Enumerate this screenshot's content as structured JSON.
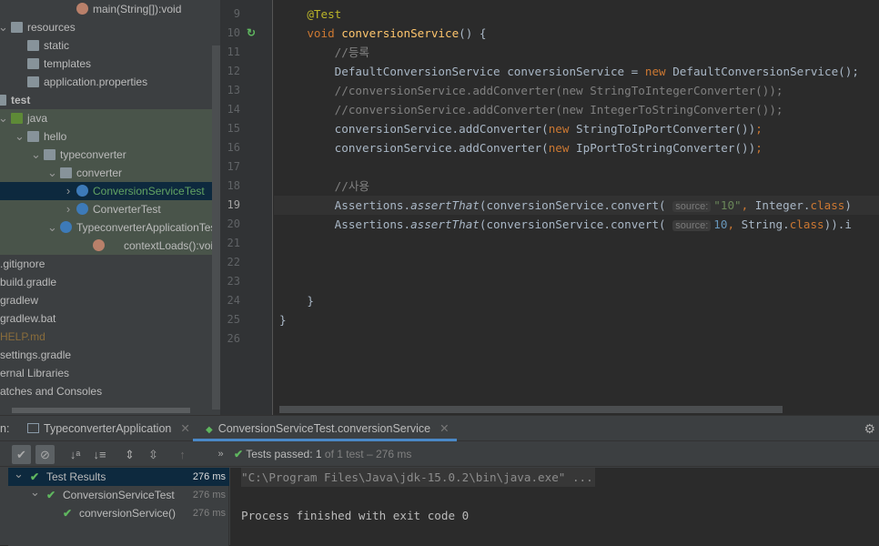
{
  "project_tree": [
    {
      "label": "main(String[]):void",
      "type": "method",
      "depth": 5,
      "arrow": ""
    },
    {
      "label": "resources",
      "type": "folder-res",
      "depth": 1,
      "arrow": "v"
    },
    {
      "label": "static",
      "type": "folder",
      "depth": 2,
      "arrow": ""
    },
    {
      "label": "templates",
      "type": "folder",
      "depth": 2,
      "arrow": ""
    },
    {
      "label": "application.properties",
      "type": "properties",
      "depth": 2,
      "arrow": ""
    },
    {
      "label": "test",
      "type": "folder-test",
      "depth": 0,
      "arrow": "",
      "bold": true
    },
    {
      "label": "java",
      "type": "folder-src",
      "depth": 1,
      "arrow": "v",
      "green": true
    },
    {
      "label": "hello",
      "type": "package",
      "depth": 2,
      "arrow": "v",
      "green": true
    },
    {
      "label": "typeconverter",
      "type": "package",
      "depth": 3,
      "arrow": "v",
      "green": true
    },
    {
      "label": "converter",
      "type": "package",
      "depth": 4,
      "arrow": "v",
      "green": true
    },
    {
      "label": "ConversionServiceTest",
      "type": "class",
      "depth": 5,
      "arrow": ">",
      "selected": true,
      "color": "#62a362"
    },
    {
      "label": "ConverterTest",
      "type": "class",
      "depth": 5,
      "arrow": ">",
      "green": true
    },
    {
      "label": "TypeconverterApplicationTests",
      "type": "class",
      "depth": 4,
      "arrow": "v",
      "green": true
    },
    {
      "label": "contextLoads():void",
      "type": "method",
      "depth": 6,
      "arrow": "",
      "green": true
    },
    {
      "label": ".gitignore",
      "type": "file",
      "depth": -1,
      "arrow": ""
    },
    {
      "label": "build.gradle",
      "type": "file",
      "depth": -1,
      "arrow": ""
    },
    {
      "label": "gradlew",
      "type": "file",
      "depth": -1,
      "arrow": ""
    },
    {
      "label": "gradlew.bat",
      "type": "file",
      "depth": -1,
      "arrow": ""
    },
    {
      "label": "HELP.md",
      "type": "file",
      "depth": -1,
      "arrow": "",
      "color": "#8a6d3b"
    },
    {
      "label": "settings.gradle",
      "type": "file",
      "depth": -1,
      "arrow": ""
    },
    {
      "label": "ernal Libraries",
      "type": "file",
      "depth": -1,
      "arrow": ""
    },
    {
      "label": "atches and Consoles",
      "type": "file",
      "depth": -1,
      "arrow": ""
    }
  ],
  "editor": {
    "current_line": 19,
    "lines": [
      {
        "n": 9,
        "tokens": [
          [
            "    ",
            ""
          ],
          [
            "@Test",
            "an"
          ]
        ]
      },
      {
        "n": 10,
        "tokens": [
          [
            "    ",
            ""
          ],
          [
            "void ",
            "kw"
          ],
          [
            "conversionService",
            "fn"
          ],
          [
            "() {",
            ""
          ]
        ]
      },
      {
        "n": 11,
        "tokens": [
          [
            "        ",
            ""
          ],
          [
            "//등록",
            "cm"
          ]
        ]
      },
      {
        "n": 12,
        "tokens": [
          [
            "        DefaultConversionService conversionService = ",
            ""
          ],
          [
            "new ",
            "kw"
          ],
          [
            "DefaultConversionService();",
            ""
          ]
        ]
      },
      {
        "n": 13,
        "tokens": [
          [
            "        ",
            ""
          ],
          [
            "//conversionService.addConverter(new StringToIntegerConverter());",
            "cm"
          ]
        ]
      },
      {
        "n": 14,
        "tokens": [
          [
            "        ",
            ""
          ],
          [
            "//conversionService.addConverter(new IntegerToStringConverter());",
            "cm"
          ]
        ]
      },
      {
        "n": 15,
        "tokens": [
          [
            "        conversionService.addConverter(",
            ""
          ],
          [
            "new ",
            "kw"
          ],
          [
            "StringToIpPortConverter())",
            ""
          ],
          [
            ";",
            "kw"
          ]
        ]
      },
      {
        "n": 16,
        "tokens": [
          [
            "        conversionService.addConverter(",
            ""
          ],
          [
            "new ",
            "kw"
          ],
          [
            "IpPortToStringConverter())",
            ""
          ],
          [
            ";",
            "kw"
          ]
        ]
      },
      {
        "n": 17,
        "tokens": []
      },
      {
        "n": 18,
        "tokens": [
          [
            "        ",
            ""
          ],
          [
            "//사용",
            "cm"
          ]
        ]
      },
      {
        "n": 19,
        "tokens": [
          [
            "        Assertions.",
            ""
          ],
          [
            "assertThat",
            "it"
          ],
          [
            "(conversionService.convert( ",
            ""
          ],
          [
            "source:",
            "hint"
          ],
          [
            "\"10\"",
            "st"
          ],
          [
            ", ",
            "kw"
          ],
          [
            "Integer.",
            ""
          ],
          [
            "class",
            "kw"
          ],
          [
            ")",
            ""
          ]
        ]
      },
      {
        "n": 20,
        "tokens": [
          [
            "        Assertions.",
            ""
          ],
          [
            "assertThat",
            "it"
          ],
          [
            "(conversionService.convert( ",
            ""
          ],
          [
            "source:",
            "hint"
          ],
          [
            "10",
            "nm"
          ],
          [
            ", ",
            "kw"
          ],
          [
            "String.",
            ""
          ],
          [
            "class",
            "kw"
          ],
          [
            ")).i",
            ""
          ]
        ]
      },
      {
        "n": 21,
        "tokens": []
      },
      {
        "n": 22,
        "tokens": []
      },
      {
        "n": 23,
        "tokens": []
      },
      {
        "n": 24,
        "tokens": [
          [
            "    }",
            ""
          ]
        ]
      },
      {
        "n": 25,
        "tokens": [
          [
            "}",
            ""
          ]
        ]
      },
      {
        "n": 26,
        "tokens": []
      }
    ]
  },
  "run_panel": {
    "prefix": "n:",
    "tabs": [
      {
        "label": "TypeconverterApplication"
      },
      {
        "label": "ConversionServiceTest.conversionService",
        "active": true
      }
    ],
    "status": {
      "prefix": "Tests passed: ",
      "passed": "1",
      "of": " of 1 test",
      "time": " – 276 ms"
    },
    "results": [
      {
        "label": "Test Results",
        "time": "276 ms",
        "depth": 0,
        "selected": true
      },
      {
        "label": "ConversionServiceTest",
        "time": "276 ms",
        "depth": 1
      },
      {
        "label": "conversionService()",
        "time": "276 ms",
        "depth": 2
      }
    ],
    "console": [
      "\"C:\\Program Files\\Java\\jdk-15.0.2\\bin\\java.exe\" ...",
      "",
      "Process finished with exit code 0"
    ]
  }
}
